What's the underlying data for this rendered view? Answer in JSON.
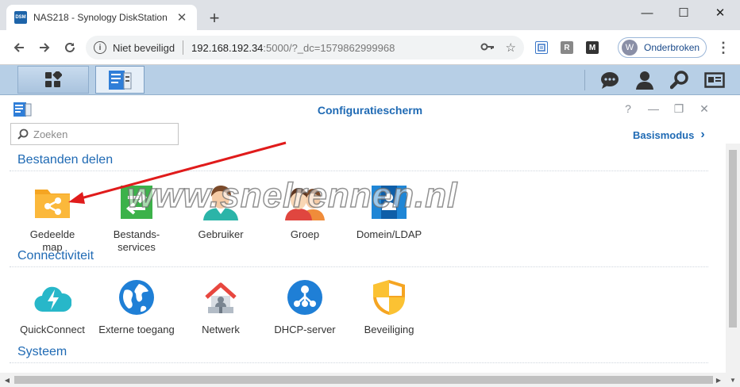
{
  "browser": {
    "tab_title": "NAS218 - Synology DiskStation",
    "tab_favicon_text": "DSM",
    "new_tab": "+",
    "window_controls": {
      "minimize": "—",
      "maximize": "☐",
      "close": "✕"
    },
    "address": {
      "security_label": "Niet beveiligd",
      "host": "192.168.192.34",
      "rest": ":5000/?_dc=1579862999968"
    },
    "extensions": [
      "R",
      "M"
    ],
    "profile": {
      "initial": "W",
      "label": "Onderbroken"
    }
  },
  "control_panel": {
    "title": "Configuratiescherm",
    "search": {
      "placeholder": "Zoeken"
    },
    "basismodus": "Basismodus",
    "window_controls": {
      "help": "?",
      "minimize": "—",
      "restore": "❐",
      "close": "✕"
    },
    "sections": [
      {
        "title": "Bestanden delen",
        "items": [
          {
            "label": "Gedeelde map",
            "icon": "shared-folder-icon"
          },
          {
            "label": "Bestands-services",
            "icon": "file-services-icon"
          },
          {
            "label": "Gebruiker",
            "icon": "user-icon"
          },
          {
            "label": "Groep",
            "icon": "group-icon"
          },
          {
            "label": "Domein/LDAP",
            "icon": "domain-ldap-icon"
          }
        ]
      },
      {
        "title": "Connectiviteit",
        "items": [
          {
            "label": "QuickConnect",
            "icon": "quickconnect-icon"
          },
          {
            "label": "Externe toegang",
            "icon": "external-access-icon"
          },
          {
            "label": "Netwerk",
            "icon": "network-icon"
          },
          {
            "label": "DHCP-server",
            "icon": "dhcp-server-icon"
          },
          {
            "label": "Beveiliging",
            "icon": "security-shield-icon"
          }
        ]
      },
      {
        "title": "Systeem",
        "items": []
      }
    ]
  },
  "watermark": "www.snelrennen.nl",
  "colors": {
    "accent_blue": "#1f6ab4",
    "dsm_bar": "#b7cfe6",
    "annotation_arrow": "#e01b1b"
  }
}
